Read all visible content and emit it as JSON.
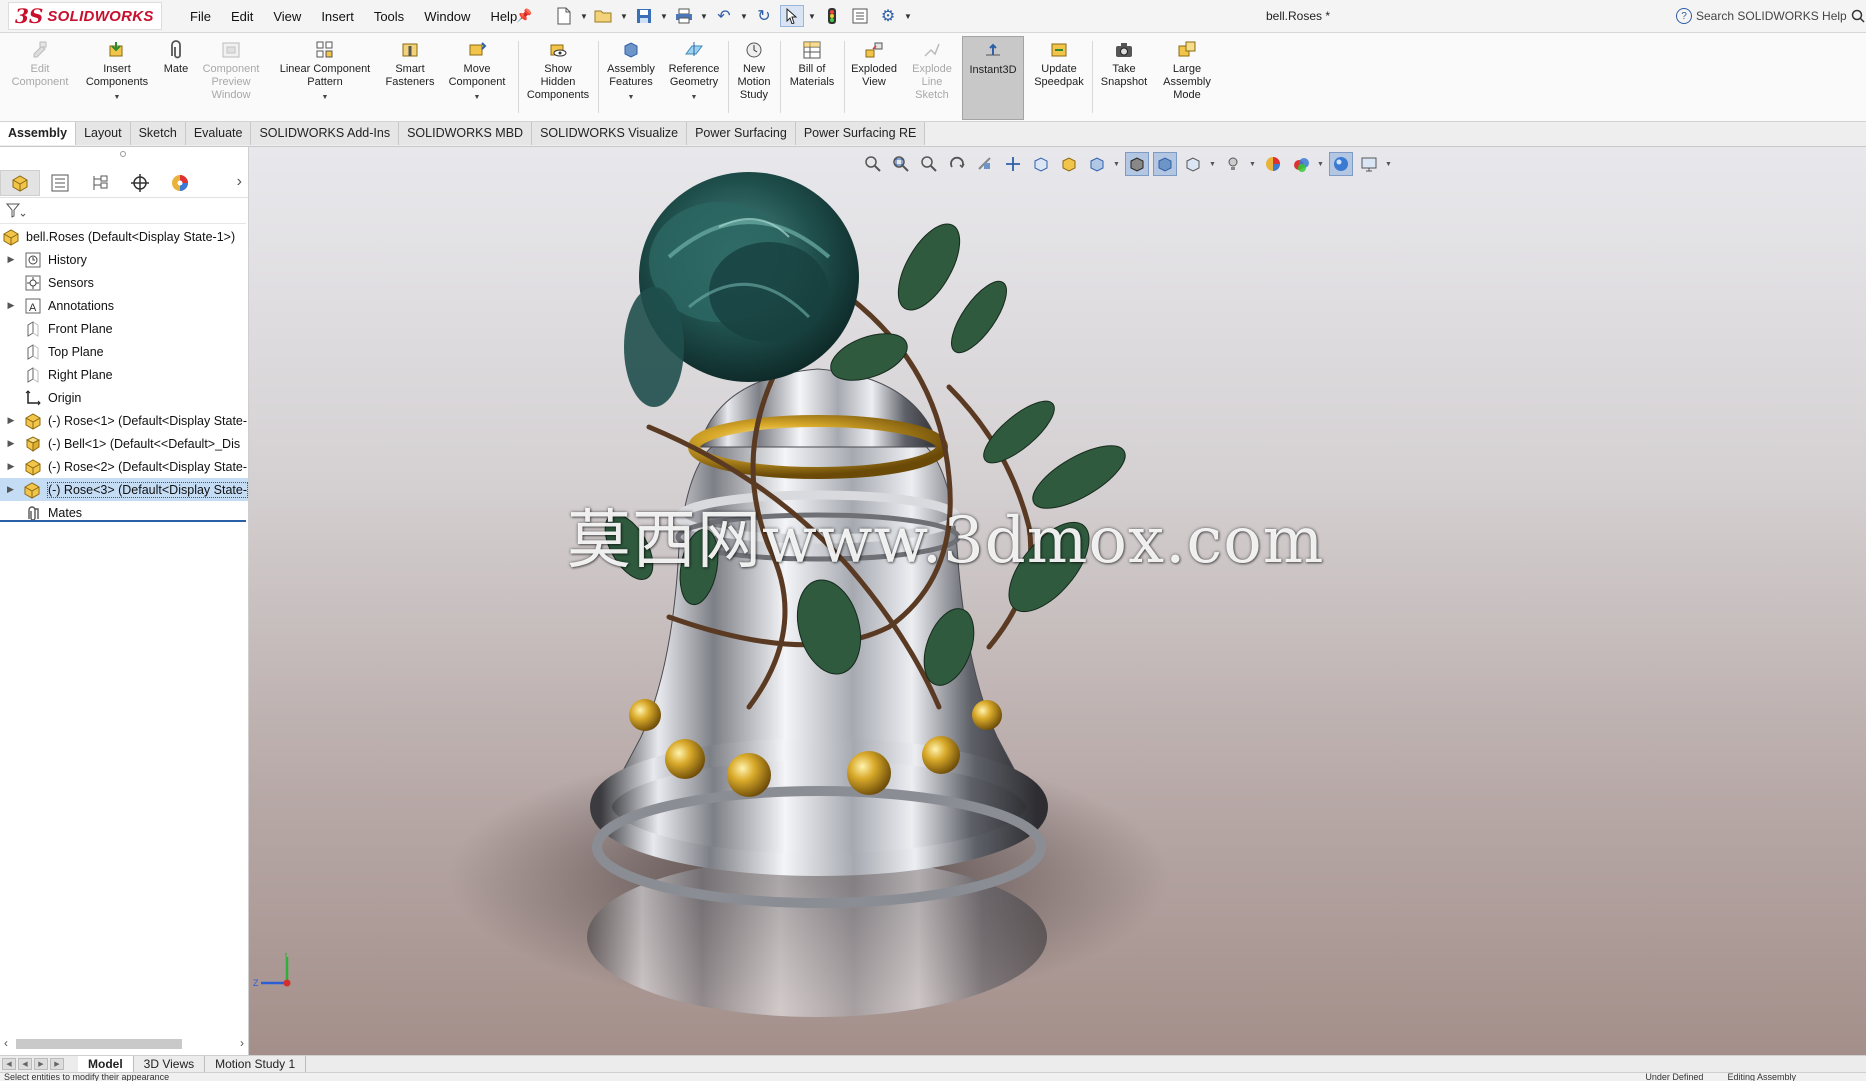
{
  "app": {
    "brand_ds": "3S",
    "brand_name": "SOLIDWORKS",
    "document_title": "bell.Roses *",
    "help_search_placeholder": "Search SOLIDWORKS Help"
  },
  "menu": [
    "File",
    "Edit",
    "View",
    "Insert",
    "Tools",
    "Window",
    "Help"
  ],
  "command_manager": {
    "edit_component": "Edit\nComponent",
    "insert_components": "Insert\nComponents",
    "mate": "Mate",
    "component_preview_window": "Component\nPreview\nWindow",
    "linear_component_pattern": "Linear Component\nPattern",
    "smart_fasteners": "Smart\nFasteners",
    "move_component": "Move\nComponent",
    "show_hidden_components": "Show\nHidden\nComponents",
    "assembly_features": "Assembly\nFeatures",
    "reference_geometry": "Reference\nGeometry",
    "new_motion_study": "New\nMotion\nStudy",
    "bill_of_materials": "Bill of\nMaterials",
    "exploded_view": "Exploded\nView",
    "explode_line_sketch": "Explode\nLine\nSketch",
    "instant3d": "Instant3D",
    "update_speedpak": "Update\nSpeedpak",
    "take_snapshot": "Take\nSnapshot",
    "large_assembly_mode": "Large\nAssembly\nMode"
  },
  "tabs": [
    "Assembly",
    "Layout",
    "Sketch",
    "Evaluate",
    "SOLIDWORKS Add-Ins",
    "SOLIDWORKS MBD",
    "SOLIDWORKS Visualize",
    "Power Surfacing",
    "Power Surfacing RE"
  ],
  "feature_tree": {
    "root": "bell.Roses  (Default<Display State-1>)",
    "items": [
      {
        "label": "History"
      },
      {
        "label": "Sensors"
      },
      {
        "label": "Annotations"
      },
      {
        "label": "Front Plane"
      },
      {
        "label": "Top Plane"
      },
      {
        "label": "Right Plane"
      },
      {
        "label": "Origin"
      },
      {
        "label": "(-) Rose<1> (Default<Display State-"
      },
      {
        "label": "(-) Bell<1> (Default<<Default>_Dis"
      },
      {
        "label": "(-) Rose<2> (Default<Display State-"
      },
      {
        "label": "(-) Rose<3> (Default<Display State-"
      },
      {
        "label": "Mates"
      }
    ]
  },
  "viewport": {
    "watermark": "莫西网www.3dmox.com",
    "triad": {
      "x": "X",
      "y": "Y",
      "z": "Z"
    },
    "colors": {
      "background_top": "#e8e8ec",
      "background_bottom": "#a48f8a",
      "bell_silver": "#c9ccd2",
      "gold": "#c9a227",
      "rose": "#1f4f4c",
      "leaf": "#2f5a3e"
    }
  },
  "bottom_tabs": [
    "Model",
    "3D Views",
    "Motion Study 1"
  ],
  "status": {
    "left": "Select entities to modify their appearance",
    "right": [
      "Under Defined",
      "Editing Assembly"
    ]
  }
}
